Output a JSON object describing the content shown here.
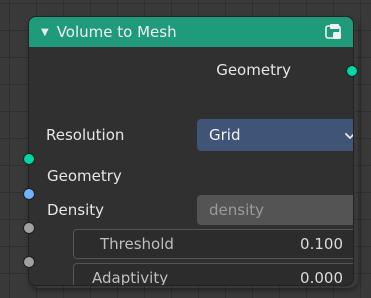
{
  "node": {
    "title": "Volume to Mesh",
    "output_label": "Geometry",
    "resolution_label": "Resolution",
    "resolution_value": "Grid",
    "inputs": {
      "geometry_label": "Geometry",
      "density_label": "Density",
      "density_placeholder": "density",
      "threshold_label": "Threshold",
      "threshold_value": "0.100",
      "adaptivity_label": "Adaptivity",
      "adaptivity_value": "0.000"
    }
  },
  "icons": {
    "collapse": "triangle-down-icon",
    "header": "geometry-node-icon",
    "dropdown": "chevron-down-icon"
  },
  "colors": {
    "header": "#1f9a7a",
    "geometry_socket": "#00d6a3",
    "string_socket": "#70b2ff",
    "float_socket": "#a1a1a1",
    "dropdown_bg": "#3f5476"
  }
}
